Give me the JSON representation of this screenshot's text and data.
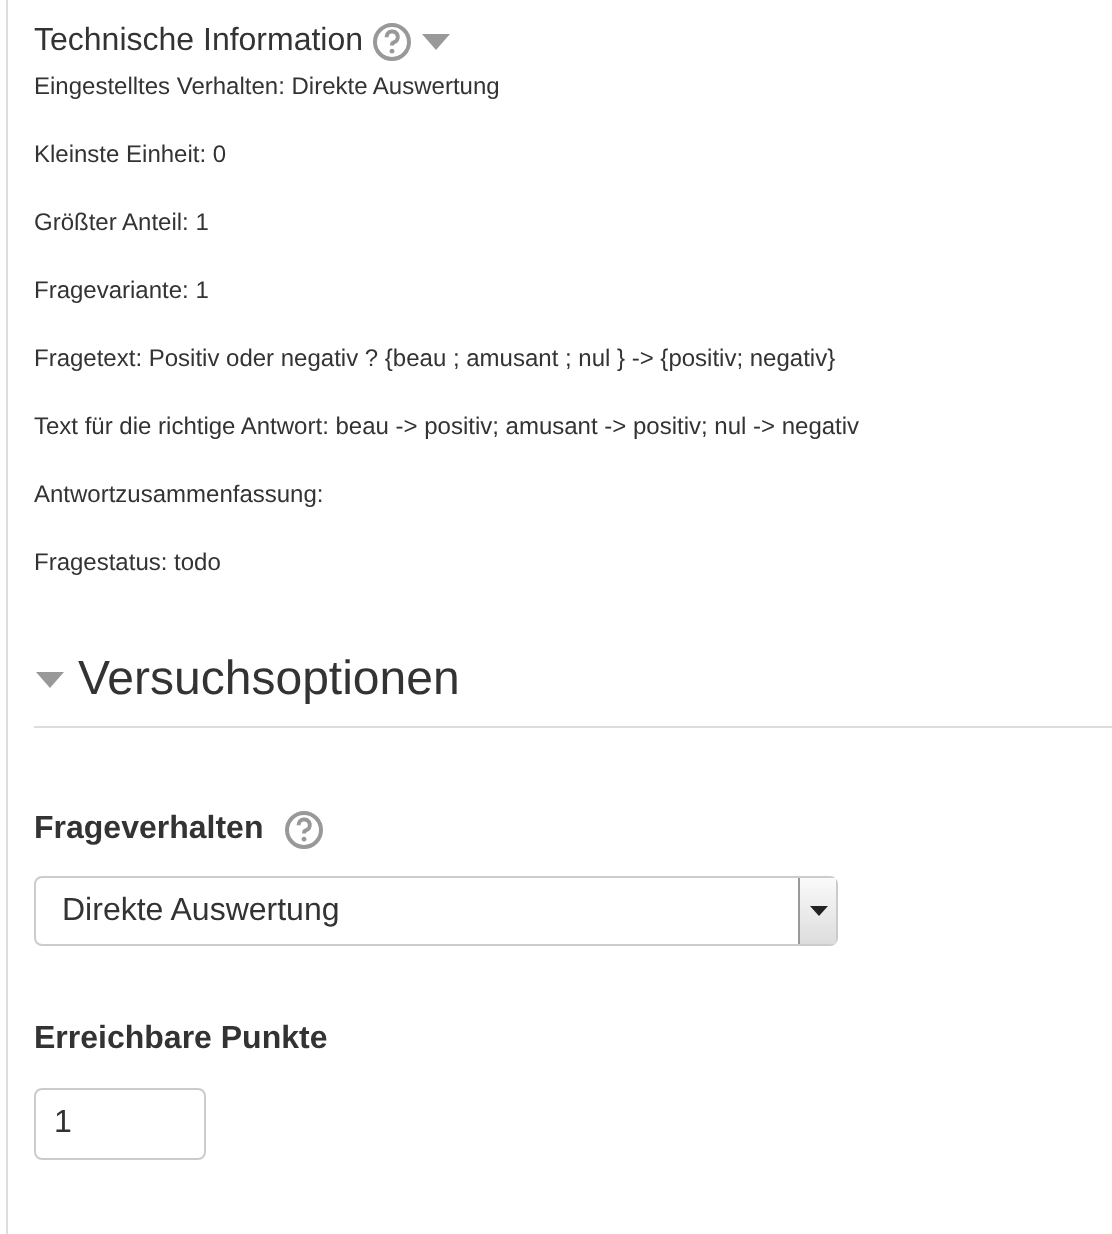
{
  "technical_info": {
    "title": "Technische Information",
    "expanded": true,
    "lines": [
      "Eingestelltes Verhalten: Direkte Auswertung",
      "Kleinste Einheit: 0",
      "Größter Anteil: 1",
      "Fragevariante: 1",
      "Fragetext: Positiv oder negativ ? {beau ; amusant ; nul } -> {positiv; negativ}",
      "Text für die richtige Antwort: beau -> positiv; amusant -> positiv; nul -> negativ",
      "Antwortzusammenfassung:",
      "Fragestatus: todo"
    ]
  },
  "section": {
    "title": "Versuchsoptionen",
    "expanded": true
  },
  "fields": [
    {
      "kind": "select",
      "label": "Frageverhalten",
      "help": true,
      "value": "Direkte Auswertung"
    },
    {
      "kind": "text",
      "label": "Erreichbare Punkte",
      "help": false,
      "value": "1"
    }
  ]
}
